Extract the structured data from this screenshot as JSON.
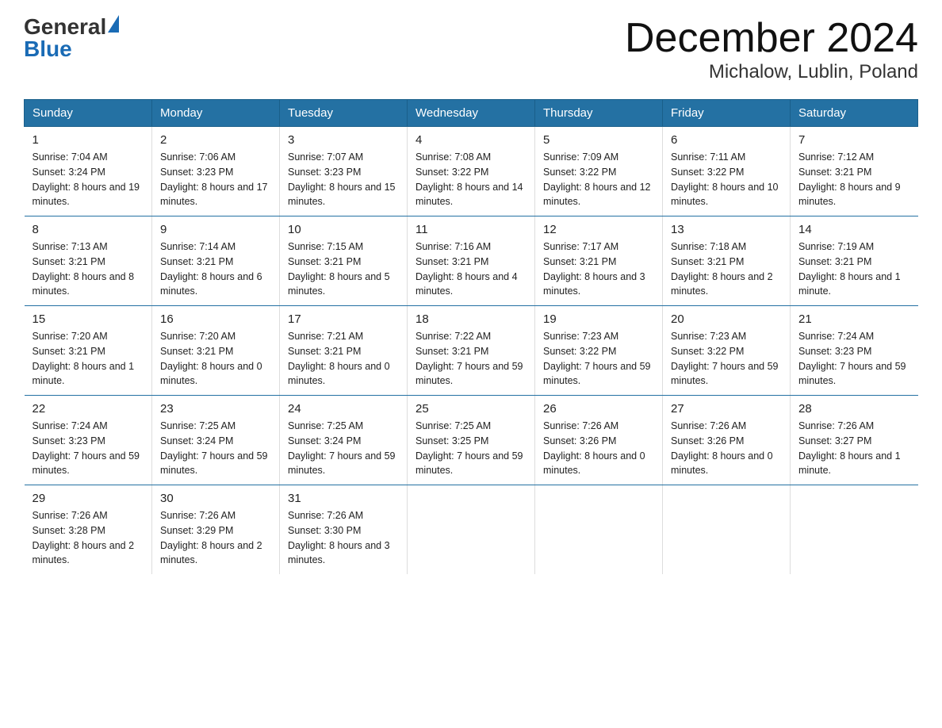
{
  "header": {
    "logo": {
      "general": "General",
      "blue": "Blue",
      "arrow": "▲"
    },
    "title": "December 2024",
    "location": "Michalow, Lublin, Poland"
  },
  "days_of_week": [
    "Sunday",
    "Monday",
    "Tuesday",
    "Wednesday",
    "Thursday",
    "Friday",
    "Saturday"
  ],
  "weeks": [
    [
      {
        "day": "1",
        "sunrise": "7:04 AM",
        "sunset": "3:24 PM",
        "daylight": "8 hours and 19 minutes."
      },
      {
        "day": "2",
        "sunrise": "7:06 AM",
        "sunset": "3:23 PM",
        "daylight": "8 hours and 17 minutes."
      },
      {
        "day": "3",
        "sunrise": "7:07 AM",
        "sunset": "3:23 PM",
        "daylight": "8 hours and 15 minutes."
      },
      {
        "day": "4",
        "sunrise": "7:08 AM",
        "sunset": "3:22 PM",
        "daylight": "8 hours and 14 minutes."
      },
      {
        "day": "5",
        "sunrise": "7:09 AM",
        "sunset": "3:22 PM",
        "daylight": "8 hours and 12 minutes."
      },
      {
        "day": "6",
        "sunrise": "7:11 AM",
        "sunset": "3:22 PM",
        "daylight": "8 hours and 10 minutes."
      },
      {
        "day": "7",
        "sunrise": "7:12 AM",
        "sunset": "3:21 PM",
        "daylight": "8 hours and 9 minutes."
      }
    ],
    [
      {
        "day": "8",
        "sunrise": "7:13 AM",
        "sunset": "3:21 PM",
        "daylight": "8 hours and 8 minutes."
      },
      {
        "day": "9",
        "sunrise": "7:14 AM",
        "sunset": "3:21 PM",
        "daylight": "8 hours and 6 minutes."
      },
      {
        "day": "10",
        "sunrise": "7:15 AM",
        "sunset": "3:21 PM",
        "daylight": "8 hours and 5 minutes."
      },
      {
        "day": "11",
        "sunrise": "7:16 AM",
        "sunset": "3:21 PM",
        "daylight": "8 hours and 4 minutes."
      },
      {
        "day": "12",
        "sunrise": "7:17 AM",
        "sunset": "3:21 PM",
        "daylight": "8 hours and 3 minutes."
      },
      {
        "day": "13",
        "sunrise": "7:18 AM",
        "sunset": "3:21 PM",
        "daylight": "8 hours and 2 minutes."
      },
      {
        "day": "14",
        "sunrise": "7:19 AM",
        "sunset": "3:21 PM",
        "daylight": "8 hours and 1 minute."
      }
    ],
    [
      {
        "day": "15",
        "sunrise": "7:20 AM",
        "sunset": "3:21 PM",
        "daylight": "8 hours and 1 minute."
      },
      {
        "day": "16",
        "sunrise": "7:20 AM",
        "sunset": "3:21 PM",
        "daylight": "8 hours and 0 minutes."
      },
      {
        "day": "17",
        "sunrise": "7:21 AM",
        "sunset": "3:21 PM",
        "daylight": "8 hours and 0 minutes."
      },
      {
        "day": "18",
        "sunrise": "7:22 AM",
        "sunset": "3:21 PM",
        "daylight": "7 hours and 59 minutes."
      },
      {
        "day": "19",
        "sunrise": "7:23 AM",
        "sunset": "3:22 PM",
        "daylight": "7 hours and 59 minutes."
      },
      {
        "day": "20",
        "sunrise": "7:23 AM",
        "sunset": "3:22 PM",
        "daylight": "7 hours and 59 minutes."
      },
      {
        "day": "21",
        "sunrise": "7:24 AM",
        "sunset": "3:23 PM",
        "daylight": "7 hours and 59 minutes."
      }
    ],
    [
      {
        "day": "22",
        "sunrise": "7:24 AM",
        "sunset": "3:23 PM",
        "daylight": "7 hours and 59 minutes."
      },
      {
        "day": "23",
        "sunrise": "7:25 AM",
        "sunset": "3:24 PM",
        "daylight": "7 hours and 59 minutes."
      },
      {
        "day": "24",
        "sunrise": "7:25 AM",
        "sunset": "3:24 PM",
        "daylight": "7 hours and 59 minutes."
      },
      {
        "day": "25",
        "sunrise": "7:25 AM",
        "sunset": "3:25 PM",
        "daylight": "7 hours and 59 minutes."
      },
      {
        "day": "26",
        "sunrise": "7:26 AM",
        "sunset": "3:26 PM",
        "daylight": "8 hours and 0 minutes."
      },
      {
        "day": "27",
        "sunrise": "7:26 AM",
        "sunset": "3:26 PM",
        "daylight": "8 hours and 0 minutes."
      },
      {
        "day": "28",
        "sunrise": "7:26 AM",
        "sunset": "3:27 PM",
        "daylight": "8 hours and 1 minute."
      }
    ],
    [
      {
        "day": "29",
        "sunrise": "7:26 AM",
        "sunset": "3:28 PM",
        "daylight": "8 hours and 2 minutes."
      },
      {
        "day": "30",
        "sunrise": "7:26 AM",
        "sunset": "3:29 PM",
        "daylight": "8 hours and 2 minutes."
      },
      {
        "day": "31",
        "sunrise": "7:26 AM",
        "sunset": "3:30 PM",
        "daylight": "8 hours and 3 minutes."
      },
      null,
      null,
      null,
      null
    ]
  ]
}
